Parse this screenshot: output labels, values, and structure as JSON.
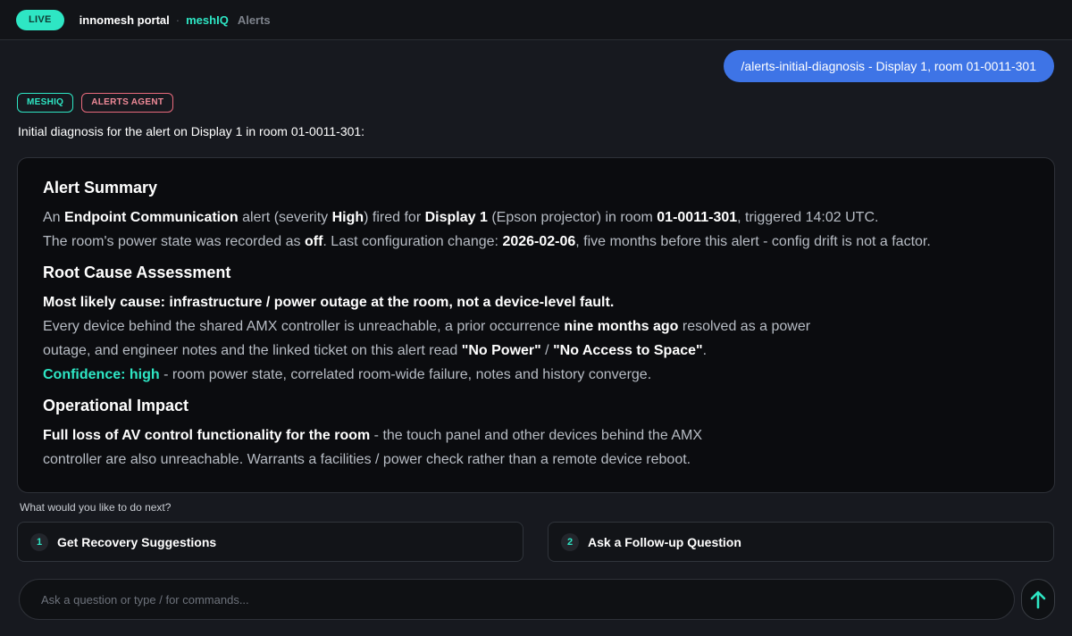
{
  "topbar": {
    "live_label": "LIVE",
    "brand": "innomesh portal",
    "separator": "·",
    "breadcrumb": [
      "meshIQ",
      "Alerts"
    ]
  },
  "user_message": "/alerts-initial-diagnosis - Display 1, room 01-0011-301",
  "tags": [
    "MESHIQ",
    "ALERTS AGENT"
  ],
  "intro": "Initial diagnosis for the alert on Display 1 in room 01-0011-301:",
  "diagnosis": {
    "summary": {
      "title": "Alert Summary",
      "line1": {
        "t1": "An ",
        "b1": "Endpoint Communication",
        "t2": " alert (severity ",
        "b2": "High",
        "t3": ") fired for ",
        "b3": "Display 1",
        "t4": " (Epson projector) in room ",
        "b4": "01-0011-301",
        "t5": ", triggered 14:02 UTC."
      },
      "line2": {
        "t1": "The room's power state was recorded as ",
        "b1": "off",
        "t2": ". Last configuration change: ",
        "b2": "2026-02-06",
        "t3": ", five months before this alert - config drift is not a factor."
      }
    },
    "root_cause": {
      "title": "Root Cause Assessment",
      "lead": "Most likely cause: infrastructure / power outage at the room, not a device-level fault.",
      "body": {
        "t1": "Every device behind the shared AMX controller is unreachable, a prior occurrence ",
        "b1": "nine months ago",
        "t2": " resolved as a power outage, and engineer notes and the linked ticket on this alert read ",
        "b2": "\"No Power\"",
        "t3": " / ",
        "b3": "\"No Access to Space\"",
        "t4": "."
      },
      "confidence_label": "Confidence: high",
      "confidence_text": " - room power state, correlated room-wide failure, notes and history converge."
    },
    "impact": {
      "title": "Operational Impact",
      "lead": "Full loss of AV control functionality for the room",
      "text": " - the touch panel and other devices behind the AMX controller are also unreachable. Warrants a facilities / power check rather than a remote device reboot."
    }
  },
  "next_prompt": "What would you like to do next?",
  "actions": [
    {
      "num": "1",
      "label": "Get Recovery Suggestions"
    },
    {
      "num": "2",
      "label": "Ask a Follow-up Question"
    }
  ],
  "input": {
    "placeholder": "Ask a question or type / for commands..."
  },
  "colors": {
    "accent": "#2ee6c4",
    "user_bubble": "#3e74e6",
    "agent_tag": "#e86a7c"
  },
  "icons": {
    "send": "arrow-up-icon"
  }
}
